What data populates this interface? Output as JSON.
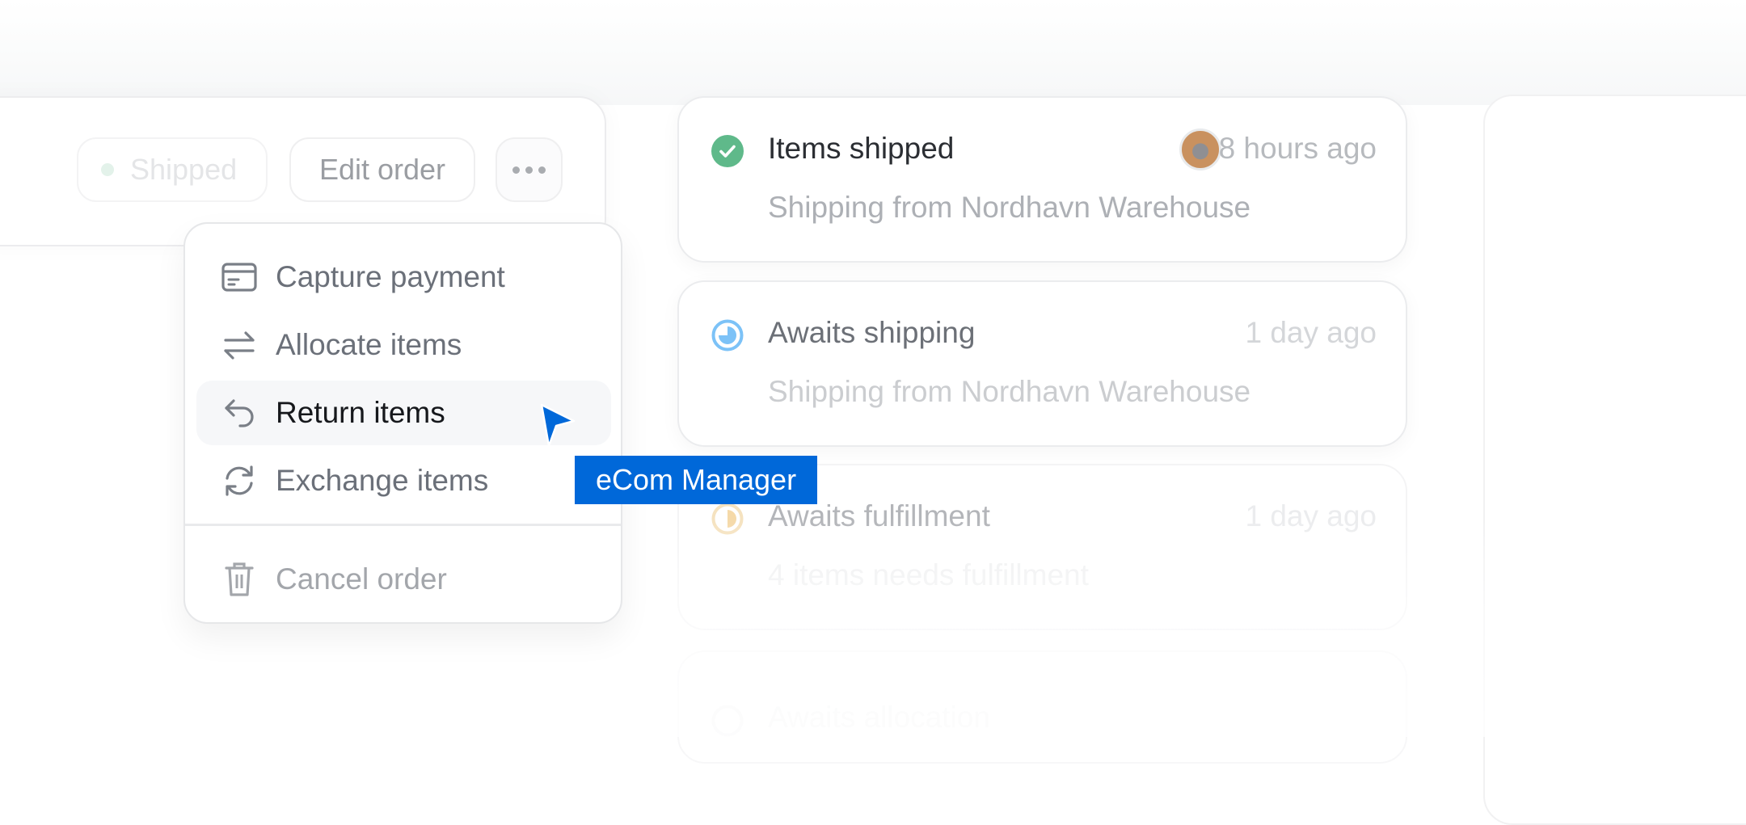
{
  "order_header": {
    "status_badge": {
      "label": "Shipped",
      "color": "#e3f2ea"
    },
    "edit_button_label": "Edit order",
    "more_button_icon": "more-horizontal-icon"
  },
  "actions_menu": {
    "items": [
      {
        "label": "Capture payment",
        "icon": "credit-card-icon",
        "state": "default"
      },
      {
        "label": "Allocate items",
        "icon": "arrows-swap-icon",
        "state": "default"
      },
      {
        "label": "Return items",
        "icon": "return-arrow-icon",
        "state": "hovered"
      },
      {
        "label": "Exchange items",
        "icon": "refresh-icon",
        "state": "default"
      }
    ],
    "danger_items": [
      {
        "label": "Cancel order",
        "icon": "trash-icon",
        "state": "muted"
      }
    ]
  },
  "cursor": {
    "label": "eCom Manager",
    "color": "#0068d9"
  },
  "timeline": [
    {
      "title": "Items shipped",
      "time": "8 hours ago",
      "subtitle": "Shipping from Nordhavn Warehouse",
      "status": "complete",
      "status_color": "#5fb98a",
      "has_avatar": true
    },
    {
      "title": "Awaits shipping",
      "time": "1 day ago",
      "subtitle": "Shipping from Nordhavn Warehouse",
      "status": "in-progress",
      "status_color": "#7cc2f7"
    },
    {
      "title": "Awaits fulfillment",
      "time": "1 day ago",
      "subtitle": "4 items needs fulfillment",
      "status": "half",
      "status_color": "#f5d9a8"
    },
    {
      "title": "Awaits allocation",
      "status": "pending"
    }
  ]
}
